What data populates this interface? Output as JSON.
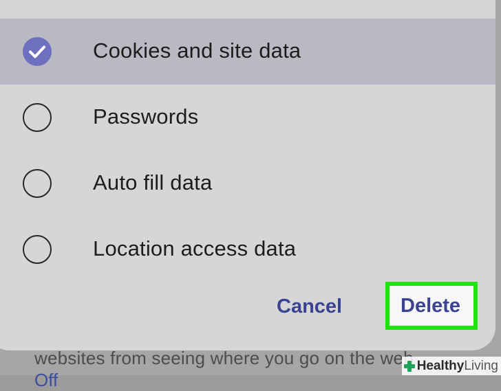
{
  "background": {
    "line1": "websites from seeing where you go on the web.",
    "line2": "Off"
  },
  "dialog": {
    "options": [
      {
        "label": "Cookies and site data",
        "checked": true
      },
      {
        "label": "Passwords",
        "checked": false
      },
      {
        "label": "Auto fill data",
        "checked": false
      },
      {
        "label": "Location access data",
        "checked": false
      }
    ],
    "cancel_label": "Cancel",
    "delete_label": "Delete"
  },
  "watermark": {
    "brand_a": "Healthy",
    "brand_b": "Living"
  },
  "colors": {
    "accent": "#3a4391",
    "check": "#6f6fbf",
    "highlight": "#22e312",
    "selected_row": "#b9b9c3"
  },
  "icons": {
    "checked_radio": "check-circle-icon",
    "unchecked_radio": "radio-empty-icon",
    "watermark": "plus-icon"
  }
}
